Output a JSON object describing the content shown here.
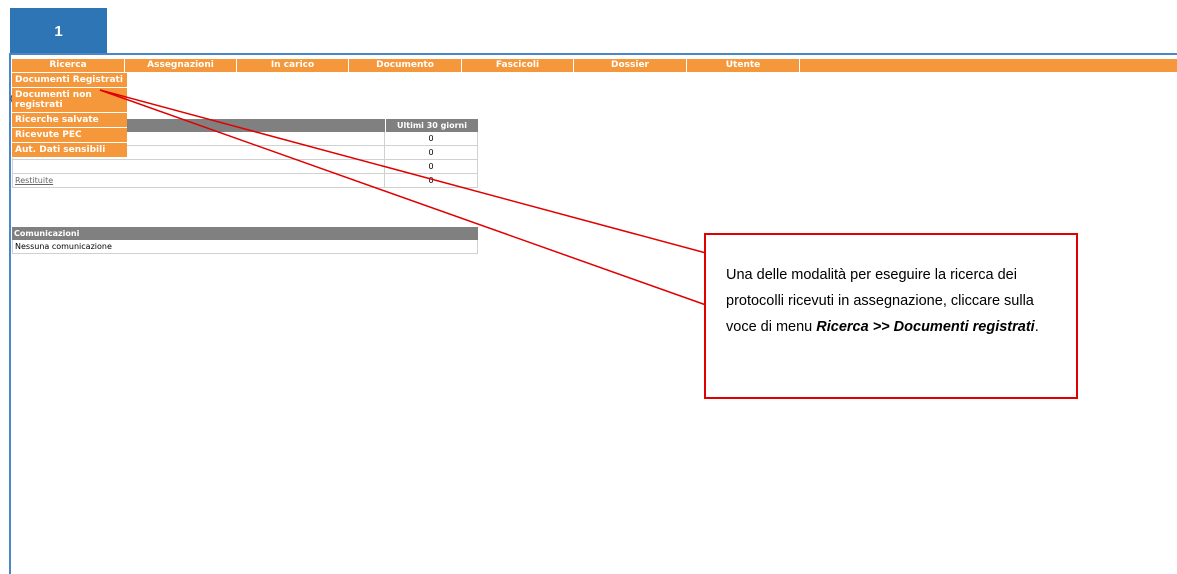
{
  "step_number": "1",
  "menu": {
    "items": [
      {
        "label": "Ricerca"
      },
      {
        "label": "Assegnazioni"
      },
      {
        "label": "In carico"
      },
      {
        "label": "Documento"
      },
      {
        "label": "Fascicoli"
      },
      {
        "label": "Dossier"
      },
      {
        "label": "Utente"
      }
    ]
  },
  "dropdown": {
    "items": [
      {
        "label": "Documenti Registrati"
      },
      {
        "label": "Documenti non registrati"
      },
      {
        "label": "Ricerche salvate"
      },
      {
        "label": "Ricevute PEC"
      },
      {
        "label": "Aut. Dati sensibili"
      }
    ]
  },
  "stats": {
    "column_header": "Ultimi 30 giorni",
    "rows": [
      {
        "label": "",
        "value": "0"
      },
      {
        "label": "",
        "value": "0"
      },
      {
        "label": "",
        "value": "0"
      },
      {
        "label": "Restituite",
        "value": "0"
      }
    ]
  },
  "communications": {
    "title": "Comunicazioni",
    "empty_text": "Nessuna comunicazione"
  },
  "callout": {
    "text": "Una delle modalità per eseguire la ricerca dei protocolli ricevuti in assegnazione, cliccare sulla voce di menu ",
    "emphasis": "Ricerca >> Documenti registrati",
    "suffix": "."
  },
  "colors": {
    "menu": "#f5983b",
    "badge": "#2e75b6",
    "callout_border": "#e00000",
    "table_header": "#808080"
  }
}
